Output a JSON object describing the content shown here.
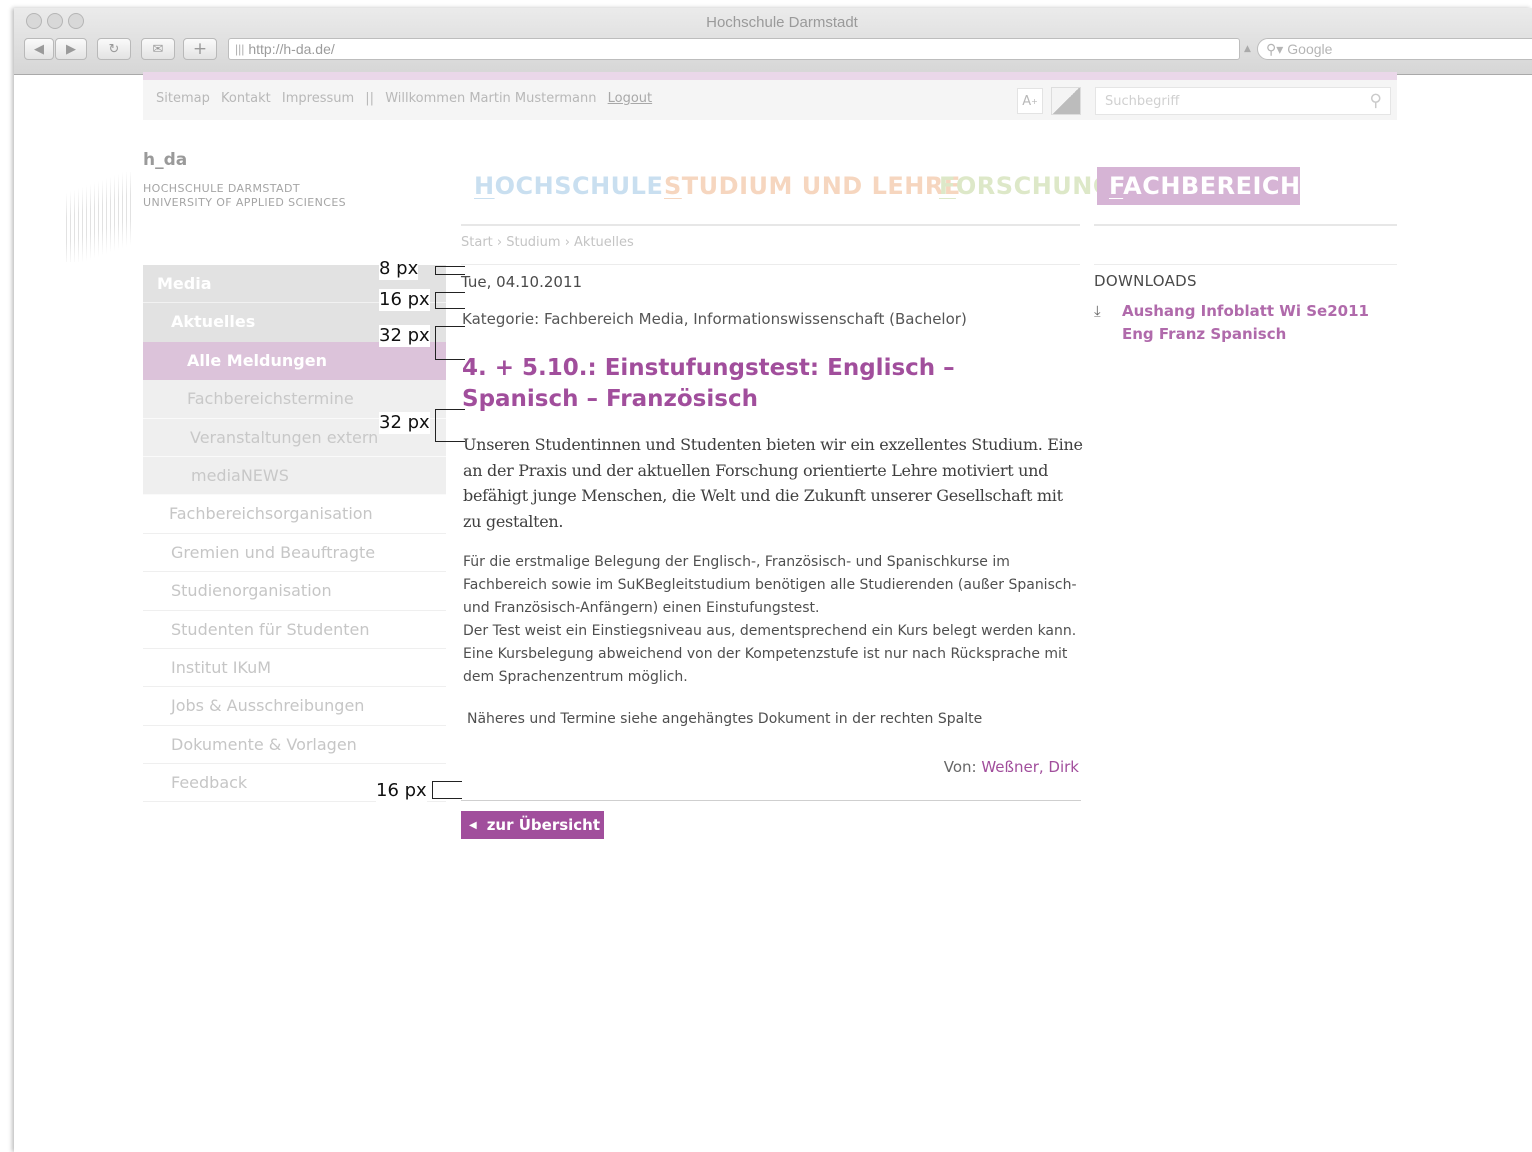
{
  "browser": {
    "window_title": "Hochschule Darmstadt",
    "url": "http://h-da.de/",
    "search_placeholder": "Google"
  },
  "util_nav": {
    "links": [
      "Sitemap",
      "Kontakt",
      "Impressum"
    ],
    "separator": "||",
    "welcome": "Willkommen Martin Mustermann",
    "logout": "Logout",
    "font_size_label": "A",
    "font_size_sup": "+",
    "search_placeholder": "Suchbegriff"
  },
  "logo": {
    "mark": "h_da",
    "line1": "HOCHSCHULE DARMSTADT",
    "line2": "UNIVERSITY OF APPLIED SCIENCES"
  },
  "main_nav": [
    {
      "first": "H",
      "rest": "OCHSCHULE"
    },
    {
      "first": "S",
      "rest": "TUDIUM UND LEHRE"
    },
    {
      "first": "F",
      "rest": "ORSCHUNG"
    },
    {
      "first": "F",
      "rest": "ACHBEREICHE"
    }
  ],
  "breadcrumb": "Start › Studium › Aktuelles",
  "sidebar": {
    "media": "Media",
    "aktuelles": "Aktuelles",
    "alle": "Alle Meldungen",
    "sub": [
      "Fachbereichstermine",
      "Veranstaltungen extern",
      "mediaNEWS"
    ],
    "top": [
      "Fachbereichsorganisation",
      "Gremien und Beauftragte",
      "Studienorganisation",
      "Studenten für Studenten",
      "Institut IKuM",
      "Jobs & Ausschreibungen",
      "Dokumente & Vorlagen",
      "Feedback"
    ]
  },
  "annotations": [
    "8 px",
    "16 px",
    "32 px",
    "32 px",
    "16 px"
  ],
  "article": {
    "date": "Tue, 04.10.2011",
    "kategorie": "Kategorie: Fachbereich Media, Informationswissenschaft (Bachelor)",
    "headline": "4. + 5.10.: Einstufungstest: Englisch – Spanisch – Französisch",
    "lead": "Unseren Studentinnen und Studenten bieten wir ein exzellentes Studium. Eine an der Praxis und der aktuellen Forschung orientierte Lehre motiviert und befähigt junge Menschen, die Welt und die Zukunft unserer Gesellschaft mit zu gestalten.",
    "body1": "Für die erstmalige Belegung der Englisch-, Französisch- und Spanischkurse im Fachbereich sowie im SuKBegleitstudium benötigen alle Studierenden (außer Spanisch- und Französisch-Anfängern) einen Einstufungstest.",
    "body2": "Der Test weist ein Einstiegsniveau aus, dementsprechend ein Kurs belegt werden kann. Eine Kursbelegung abweichend von der Kompetenzstufe ist nur nach Rücksprache mit dem Sprachenzentrum möglich.",
    "naeheres": "Näheres und Termine siehe angehängtes Dokument in der rechten Spalte",
    "author_prefix": "Von:",
    "author": "Weßner, Dirk",
    "back": "zur Übersicht"
  },
  "downloads": {
    "title": "DOWNLOADS",
    "link": "Aushang Infoblatt Wi Se2011 Eng Franz Spanisch"
  }
}
